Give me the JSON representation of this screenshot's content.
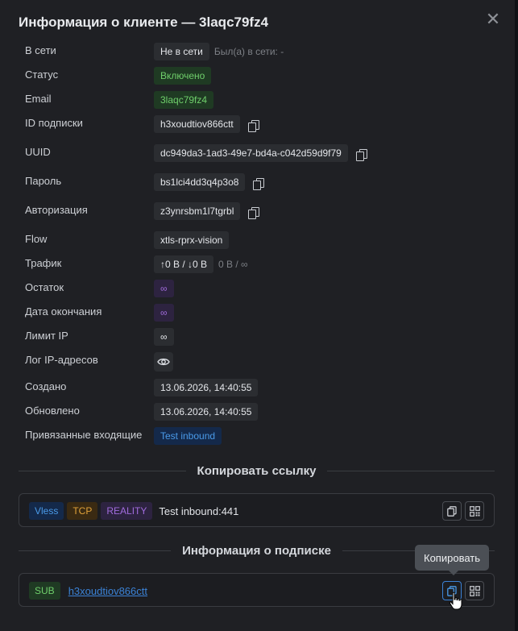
{
  "modal": {
    "title": "Информация о клиенте — 3laqc79fz4",
    "close_icon": "close-icon"
  },
  "fields": {
    "online": {
      "label": "В сети",
      "value": "Не в сети",
      "last_seen": "Был(а) в сети: -"
    },
    "status": {
      "label": "Статус",
      "value": "Включено"
    },
    "email": {
      "label": "Email",
      "value": "3laqc79fz4"
    },
    "sub_id": {
      "label": "ID подписки",
      "value": "h3xoudtiov866ctt"
    },
    "uuid": {
      "label": "UUID",
      "value": "dc949da3-1ad3-49e7-bd4a-c042d59d9f79"
    },
    "password": {
      "label": "Пароль",
      "value": "bs1lci4dd3q4p3o8"
    },
    "auth": {
      "label": "Авторизация",
      "value": "z3ynrsbm1l7tgrbl"
    },
    "flow": {
      "label": "Flow",
      "value": "xtls-rprx-vision"
    },
    "traffic": {
      "label": "Трафик",
      "value": "↑0 B / ↓0 B",
      "total": "0 B / ∞"
    },
    "remaining": {
      "label": "Остаток",
      "value": "∞"
    },
    "expiry": {
      "label": "Дата окончания",
      "value": "∞"
    },
    "ip_limit": {
      "label": "Лимит IP",
      "value": "∞"
    },
    "ip_log": {
      "label": "Лог IP-адресов"
    },
    "created": {
      "label": "Создано",
      "value": "13.06.2026, 14:40:55"
    },
    "updated": {
      "label": "Обновлено",
      "value": "13.06.2026, 14:40:55"
    },
    "inbounds": {
      "label": "Привязанные входящие",
      "value": "Test inbound"
    }
  },
  "copy_link": {
    "heading": "Копировать ссылку",
    "protocol": "Vless",
    "transport": "TCP",
    "security": "REALITY",
    "name": "Test inbound:441"
  },
  "subscription": {
    "heading": "Информация о подписке",
    "badge": "SUB",
    "link": "h3xoudtiov866ctt"
  },
  "tooltip": {
    "text": "Копировать"
  },
  "colors": {
    "background": "#1f2024",
    "green": "#6fcf6b",
    "purple": "#a06bdb",
    "blue": "#4a9ae8",
    "orange": "#e0a23a"
  }
}
